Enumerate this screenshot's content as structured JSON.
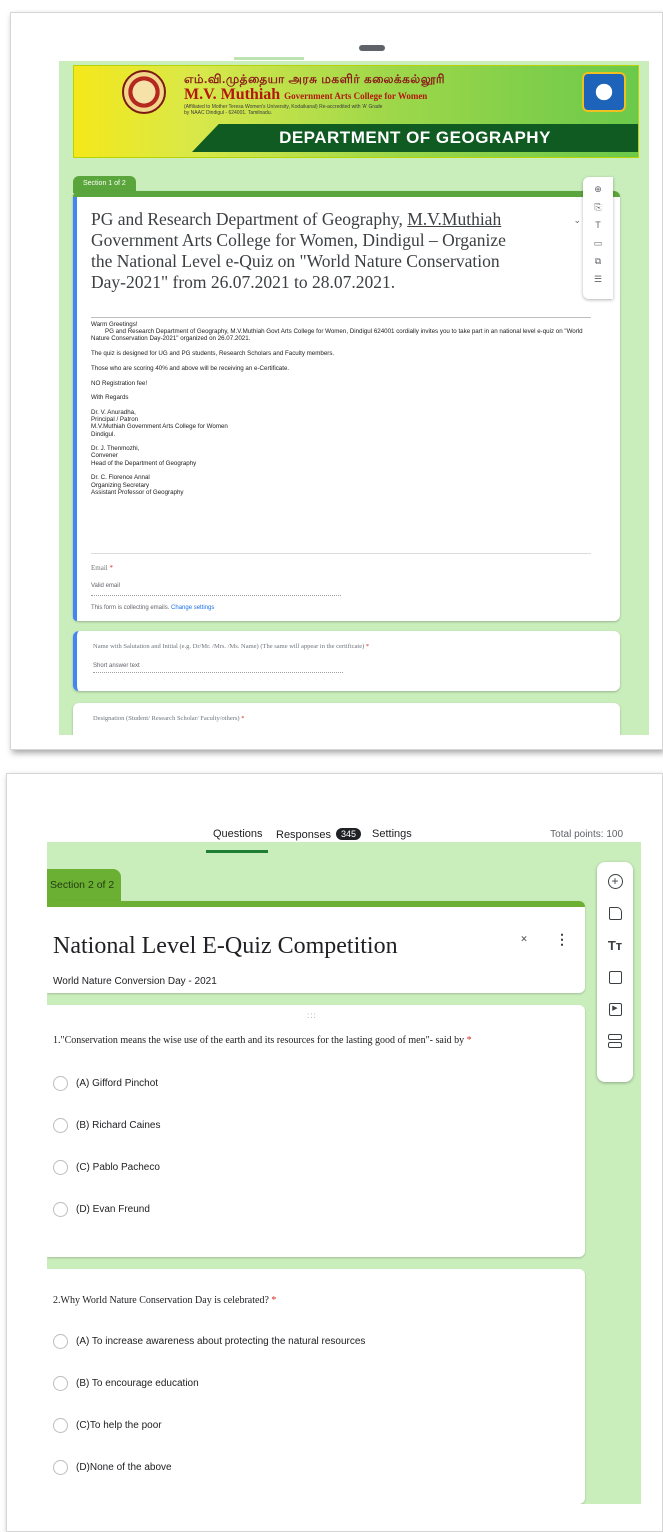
{
  "shot1": {
    "banner": {
      "tamil_name": "எம்.வி.முத்தையா அரசு மகளிர் கலைக்கல்லூரி",
      "college_name": "M.V. Muthiah",
      "college_sub": "Government Arts College for Women",
      "affiliation": "(Affiliated to Mother Teresa Women's University, Kodaikanal) Re-accredited with 'A' Grade by NAAC Dindigul - 624001. Tamilnadu.",
      "department": "DEPARTMENT OF GEOGRAPHY"
    },
    "section_label": "Section 1 of 2",
    "title_part1": "PG and Research Department of Geography, ",
    "title_link": "M.V.Muthiah",
    "title_part2": " Government Arts College for Women, Dindigul – Organize the National Level e-Quiz on \"World Nature Conservation Day-2021\" from 26.07.2021 to 28.07.2021.",
    "description": {
      "greeting": "Warm Greetings!",
      "invite": "PG and Research Department of Geography, M.V.Muthiah Govt Arts College for Women, Dindigul 624001 cordially invites you to take part in an national level e-quiz on \"World Nature Conservation Day-2021\" organized on 26.07.2021.",
      "designed_for": "The quiz is designed for UG and PG students, Research Scholars and Faculty members.",
      "certificate": "Those who are scoring 40% and above will be receiving an e-Certificate.",
      "no_fee": "NO Registration fee!",
      "regards": "With Regards",
      "patron": "Dr. V. Anuradha,\nPrincipal / Patron\nM.V.Muthiah Government Arts College for Women\nDindigul.",
      "convener": "Dr. J. Thenmozhi,\nConvener\nHead of the Department of Geography",
      "secretary": "Dr. C. Florence Annal\nOrganizing Secretary\nAssistant Professor of Geography"
    },
    "email_label": "Email",
    "email_placeholder": "Valid email",
    "collecting_text": "This form is collecting emails.",
    "change_settings": "Change settings",
    "q_name": "Name with Salutation and Initial (e.g. Dr/Mr. /Mrs. /Ms. Name) (The same will appear in the certificate)",
    "q_designation": "Designation (Student/ Research Scholar/ Faculty/others)",
    "short_answer": "Short answer text",
    "required_mark": "*"
  },
  "shot2": {
    "tabs": {
      "questions": "Questions",
      "responses": "Responses",
      "responses_count": "345",
      "settings": "Settings"
    },
    "total_points": "Total points: 100",
    "section_label": "Section 2 of 2",
    "title": "National Level E-Quiz Competition",
    "subtitle": "World Nature Conversion Day - 2021",
    "drag_handle": ":::",
    "q1": {
      "text": "1.\"Conservation means the wise use of the earth and its resources for the lasting good of men\"- said by",
      "options": [
        "(A) Gifford Pinchot",
        "(B) Richard Caines",
        "(C) Pablo Pacheco",
        "(D) Evan Freund"
      ]
    },
    "q2": {
      "text": "2.Why World Nature Conservation Day is celebrated?",
      "options": [
        "(A) To increase awareness about protecting the natural resources",
        "(B) To encourage education",
        "(C)To help the poor",
        "(D)None of the above"
      ]
    },
    "required_mark": "*"
  },
  "colors": {
    "theme_green": "#6cb033",
    "background_green": "#c9eebc",
    "accent_blue": "#4285f4",
    "required_red": "#d93025"
  }
}
